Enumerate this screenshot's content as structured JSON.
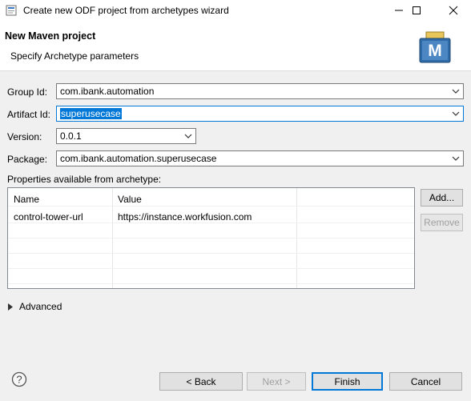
{
  "window": {
    "title": "Create new ODF project from archetypes wizard"
  },
  "header": {
    "title": "New Maven project",
    "subtitle": "Specify Archetype parameters",
    "logo_letter": "M"
  },
  "form": {
    "group_id": {
      "label": "Group Id:",
      "value": "com.ibank.automation"
    },
    "artifact_id": {
      "label": "Artifact Id:",
      "value": "superusecase"
    },
    "version": {
      "label": "Version:",
      "value": "0.0.1"
    },
    "package": {
      "label": "Package:",
      "value": "com.ibank.automation.superusecase"
    }
  },
  "properties": {
    "label": "Properties available from archetype:",
    "columns": [
      "Name",
      "Value"
    ],
    "rows": [
      {
        "name": "control-tower-url",
        "value": "https://instance.workfusion.com"
      }
    ],
    "add_label": "Add...",
    "remove_label": "Remove"
  },
  "advanced_label": "Advanced",
  "footer": {
    "back_label": "< Back",
    "next_label": "Next >",
    "finish_label": "Finish",
    "cancel_label": "Cancel"
  },
  "icons": {
    "app": "wizard-app-icon",
    "minimize": "minimize-icon",
    "maximize": "maximize-icon",
    "close": "close-icon",
    "help": "help-icon",
    "logo": "maven-logo-icon"
  },
  "colors": {
    "selection": "#0078d7",
    "focus_border": "#0078d7",
    "logo_blue": "#2f6ba8"
  }
}
